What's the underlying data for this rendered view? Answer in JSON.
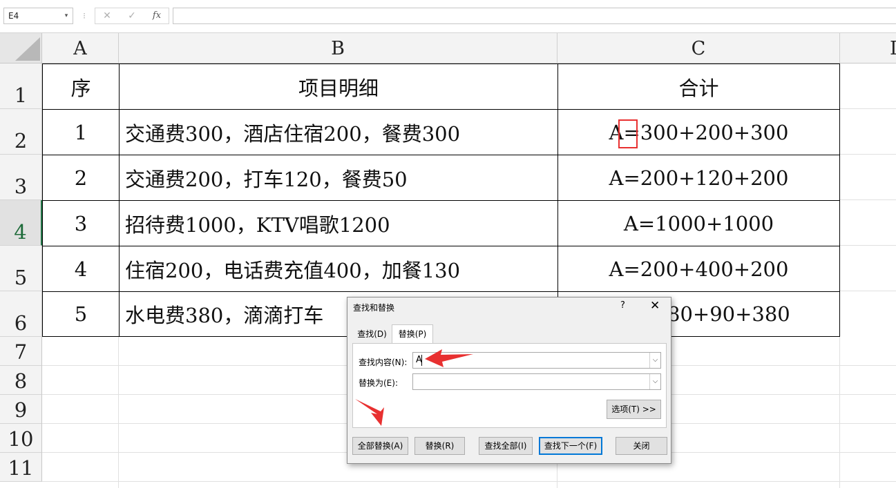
{
  "formula_bar": {
    "name_box": "E4",
    "name_arrow": "▾",
    "separator": "⁝",
    "cancel_icon": "✕",
    "enter_icon": "✓",
    "fx_icon": "fx",
    "formula": ""
  },
  "columns": [
    "A",
    "B",
    "C",
    "D"
  ],
  "rows": [
    "1",
    "2",
    "3",
    "4",
    "5",
    "6",
    "7",
    "8",
    "9",
    "10",
    "11"
  ],
  "selected_row": "4",
  "table": {
    "header": [
      "序",
      "项目明细",
      "合计"
    ],
    "body": [
      [
        "1",
        "交通费300，酒店住宿200，餐费300",
        "A=300+200+300"
      ],
      [
        "2",
        "交通费200，打车120，餐费50",
        "A=200+120+200"
      ],
      [
        "3",
        "招待费1000，KTV唱歌1200",
        "A=1000+1000"
      ],
      [
        "4",
        "住宿200，电话费充值400，加餐130",
        "A=200+400+200"
      ],
      [
        "5",
        "水电费380，滴滴打车",
        "80+90+380"
      ]
    ]
  },
  "dialog": {
    "title": "查找和替换",
    "help": "?",
    "close": "✕",
    "tabs": [
      "查找(D)",
      "替换(P)"
    ],
    "active_tab": "替换(P)",
    "find_label": "查找内容(N):",
    "find_value": "A",
    "replace_label": "替换为(E):",
    "replace_value": "",
    "combo_arrow": "⌵",
    "options_button": "选项(T) >>",
    "buttons": {
      "replace_all": "全部替换(A)",
      "replace": "替换(R)",
      "find_all": "查找全部(I)",
      "find_next": "查找下一个(F)",
      "close": "关闭"
    }
  },
  "colors": {
    "annotation_red": "#e83030",
    "selection_green": "#217346",
    "default_button_blue": "#0078d7"
  }
}
